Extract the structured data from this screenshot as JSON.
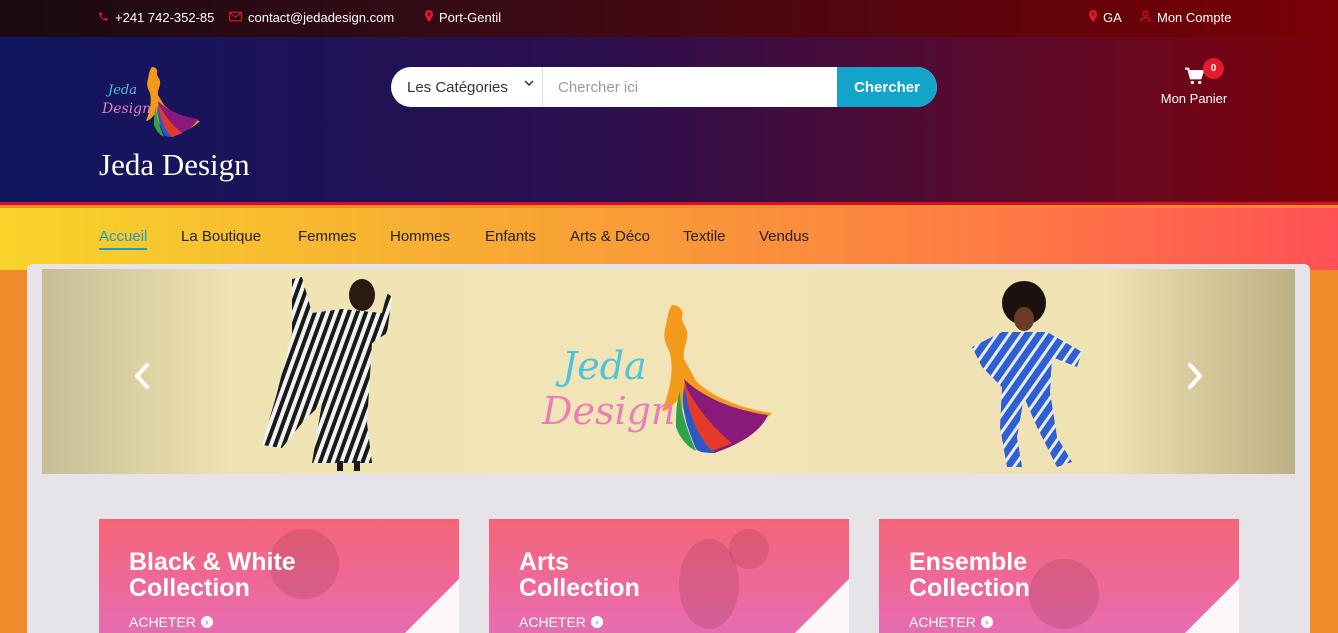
{
  "topbar": {
    "phone": "+241 742-352-85",
    "email": "contact@jedadesign.com",
    "city": "Port-Gentil",
    "country": "GA",
    "account": "Mon Compte"
  },
  "header": {
    "brand": "Jeda Design",
    "logo_text_1": "Jeda",
    "logo_text_2": "Design",
    "search": {
      "category": "Les Catégories",
      "placeholder": "Chercher ici",
      "button": "Chercher"
    },
    "cart": {
      "count": "0",
      "label": "Mon Panier"
    }
  },
  "nav": {
    "items": [
      "Accueil",
      "La Boutique",
      "Femmes",
      "Hommes",
      "Enfants",
      "Arts & Déco",
      "Textile",
      "Vendus"
    ],
    "active": "Accueil"
  },
  "slider": {
    "logo_text_1": "Jeda",
    "logo_text_2": "Design"
  },
  "collections": [
    {
      "title": "Black & White\nCollection",
      "cta": "ACHETER"
    },
    {
      "title": "Arts\nCollection",
      "cta": "ACHETER"
    },
    {
      "title": "Ensemble\nCollection",
      "cta": "ACHETER"
    }
  ],
  "colors": {
    "accent": "#13a4c9",
    "brand_red": "#e31a2c"
  },
  "icons": [
    "phone-icon",
    "envelope-icon",
    "map-pin-icon",
    "user-icon",
    "cart-icon",
    "chevron-left-icon",
    "chevron-right-icon",
    "arrow-circle-right-icon"
  ]
}
